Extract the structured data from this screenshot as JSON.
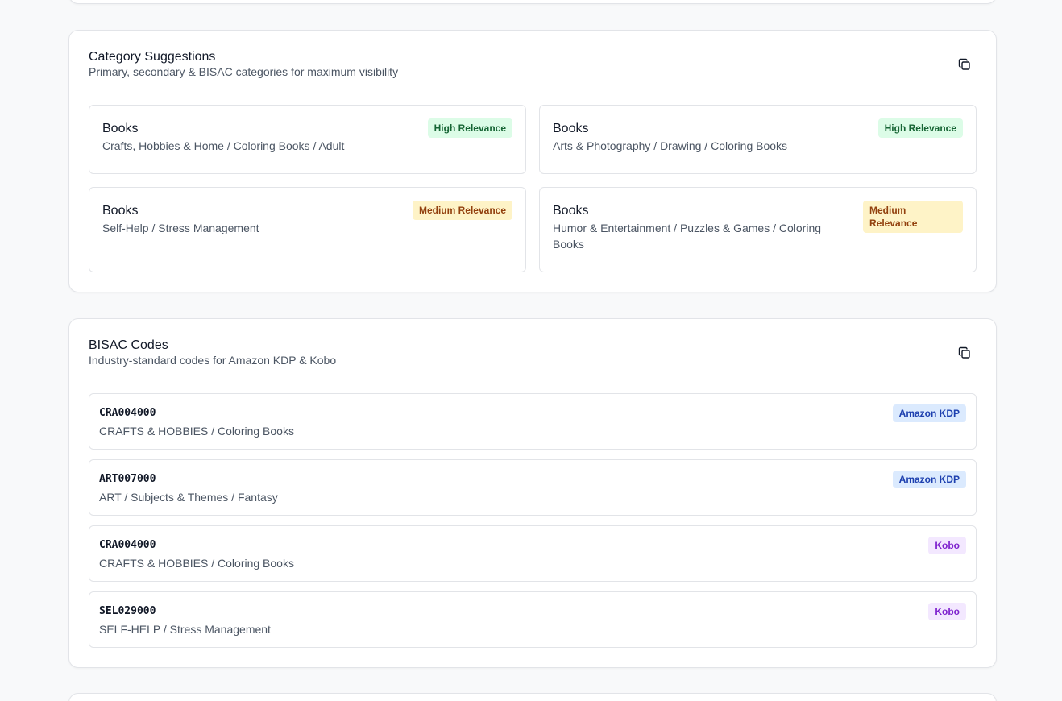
{
  "categories_section": {
    "title": "Category Suggestions",
    "subtitle": "Primary, secondary & BISAC categories for maximum visibility",
    "copy_icon": "copy-icon",
    "items": [
      {
        "main": "Books",
        "path": "Crafts, Hobbies & Home / Coloring Books / Adult",
        "relevance": "High Relevance",
        "level": "high"
      },
      {
        "main": "Books",
        "path": "Arts & Photography / Drawing / Coloring Books",
        "relevance": "High Relevance",
        "level": "high"
      },
      {
        "main": "Books",
        "path": "Self-Help / Stress Management",
        "relevance": "Medium Relevance",
        "level": "medium"
      },
      {
        "main": "Books",
        "path": "Humor & Entertainment / Puzzles & Games / Coloring Books",
        "relevance": "Medium Relevance",
        "level": "medium"
      }
    ]
  },
  "bisac_section": {
    "title": "BISAC Codes",
    "subtitle": "Industry-standard codes for Amazon KDP & Kobo",
    "copy_icon": "copy-icon",
    "items": [
      {
        "code": "CRA004000",
        "description": "CRAFTS & HOBBIES / Coloring Books",
        "platform": "Amazon KDP"
      },
      {
        "code": "ART007000",
        "description": "ART / Subjects & Themes / Fantasy",
        "platform": "Amazon KDP"
      },
      {
        "code": "CRA004000",
        "description": "CRAFTS & HOBBIES / Coloring Books",
        "platform": "Kobo"
      },
      {
        "code": "SEL029000",
        "description": "SELF-HELP / Stress Management",
        "platform": "Kobo"
      }
    ]
  },
  "colors": {
    "high_badge_bg": "#dcfce7",
    "high_badge_text": "#166534",
    "medium_badge_bg": "#fef3c7",
    "medium_badge_text": "#92400e",
    "kdp_badge_bg": "#dbeafe",
    "kdp_badge_text": "#1e40af",
    "kobo_badge_bg": "#f3e8ff",
    "kobo_badge_text": "#7e22ce"
  }
}
